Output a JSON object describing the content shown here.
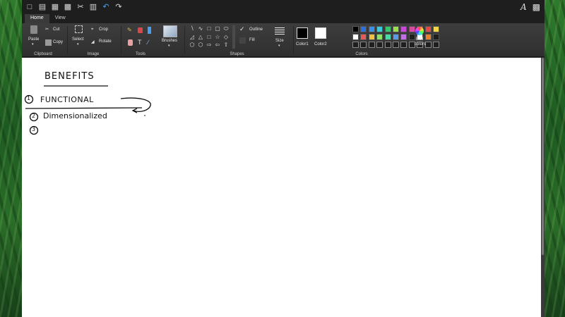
{
  "app": {
    "tabs": [
      {
        "label": "Home"
      },
      {
        "label": "View"
      }
    ]
  },
  "ribbon": {
    "clipboard": {
      "group_label": "Clipboard",
      "paste": "Paste",
      "cut": "Cut",
      "copy": "Copy"
    },
    "image": {
      "group_label": "Image",
      "select": "Select",
      "crop": "Crop",
      "rotate": "Rotate"
    },
    "tools": {
      "group_label": "Tools"
    },
    "brushes": {
      "label": "Brushes"
    },
    "shapes": {
      "group_label": "Shapes",
      "outline": "Outline",
      "fill": "Fill"
    },
    "size": {
      "label": "Size"
    },
    "colors": {
      "group_label": "Colors",
      "color1": "Color1",
      "color2": "Color2",
      "edit_colors": "Edit colors",
      "color1_value": "#000000",
      "color2_value": "#ffffff",
      "palette_row1": [
        "#000000",
        "#2e6fe0",
        "#3a8fe8",
        "#3ec8d8",
        "#39c46b",
        "#9be04a",
        "#c84ad8",
        "#d84aa0",
        "#e88a2a",
        "#e24848",
        "#f0d64a"
      ],
      "palette_row2": [
        "#ffffff",
        "#e85a5a",
        "#f0c040",
        "#8ee06a",
        "#4ad8a8",
        "#5a9ae8",
        "#c070e0",
        "#1e1e1e",
        "#ffffff",
        "#e8802a",
        "#1e1e1e"
      ],
      "palette_row3_blank_count": 11
    }
  },
  "canvas": {
    "handwriting": {
      "title": "BENEFITS",
      "item1_number": "1",
      "item1_text": "FUNCTIONAL",
      "item2_number": "2",
      "item2_text": "Dimensionalized",
      "item3_number": "3"
    }
  }
}
